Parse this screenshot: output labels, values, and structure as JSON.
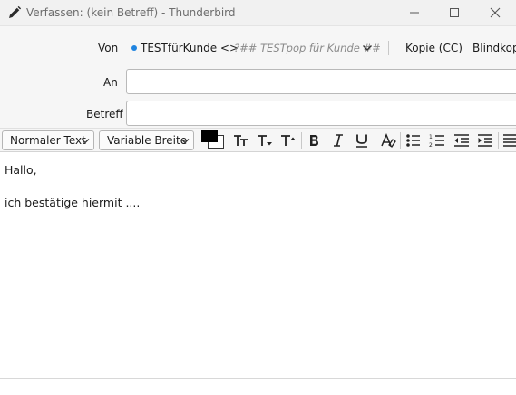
{
  "window": {
    "title": "Verfassen: (kein Betreff) - Thunderbird"
  },
  "header": {
    "from_label": "Von",
    "identity_name": "TESTfürKunde <>",
    "identity_description": "?## TESTpop für Kunde ##",
    "cc_label": "Kopie (CC)",
    "bcc_label": "Blindkopie",
    "to_label": "An",
    "to_value": "",
    "subject_label": "Betreff",
    "subject_value": ""
  },
  "toolbar": {
    "paragraph_format": "Normaler Text",
    "font": "Variable Breite",
    "text_color": "#000000",
    "background_color": "#ffffff",
    "icons": [
      "font-smaller-icon",
      "font-size-icon",
      "font-larger-icon",
      "bold-icon",
      "italic-icon",
      "underline-icon",
      "remove-styles-icon",
      "bullet-list-icon",
      "numbered-list-icon",
      "outdent-icon",
      "indent-icon",
      "align-icon"
    ]
  },
  "body": {
    "lines": [
      "Hallo,",
      "ich bestätige hiermit ...."
    ]
  },
  "colors": {
    "accent": "#1f84e0",
    "chrome": "#f6f6f6"
  }
}
